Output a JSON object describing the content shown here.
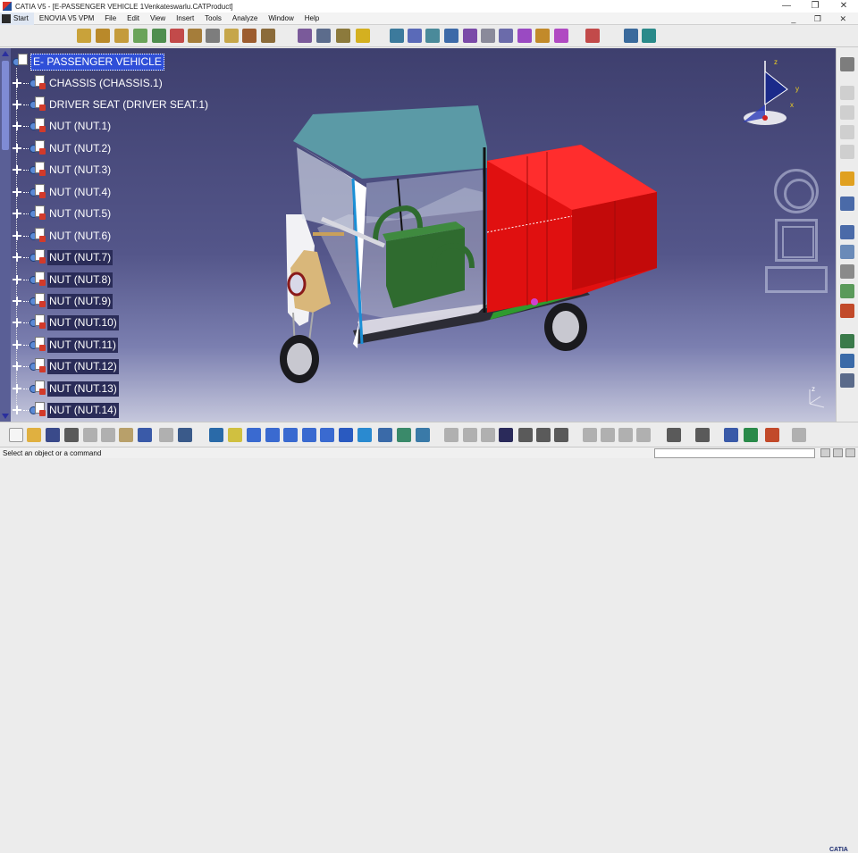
{
  "window": {
    "title": "CATIA V5 - [E-PASSENGER VEHICLE 1Venkateswarlu.CATProduct]",
    "controls": [
      "—",
      "❐",
      "✕"
    ]
  },
  "menu": {
    "items": [
      "Start",
      "ENOVIA V5 VPM",
      "File",
      "Edit",
      "View",
      "Insert",
      "Tools",
      "Analyze",
      "Window",
      "Help"
    ],
    "doc_controls": "_ ❐ ✕"
  },
  "tree": {
    "root": "E- PASSENGER VEHICLE",
    "items": [
      {
        "label": "CHASSIS (CHASSIS.1)"
      },
      {
        "label": "DRIVER SEAT (DRIVER SEAT.1)"
      },
      {
        "label": "NUT (NUT.1)"
      },
      {
        "label": "NUT (NUT.2)"
      },
      {
        "label": "NUT (NUT.3)"
      },
      {
        "label": "NUT (NUT.4)"
      },
      {
        "label": "NUT (NUT.5)"
      },
      {
        "label": "NUT (NUT.6)"
      },
      {
        "label": "NUT (NUT.7)"
      },
      {
        "label": "NUT (NUT.8)"
      },
      {
        "label": "NUT (NUT.9)"
      },
      {
        "label": "NUT (NUT.10)"
      },
      {
        "label": "NUT (NUT.11)"
      },
      {
        "label": "NUT (NUT.12)"
      },
      {
        "label": "NUT (NUT.13)"
      },
      {
        "label": "NUT (NUT.14)"
      }
    ]
  },
  "compass": {
    "x_label": "x",
    "y_label": "y",
    "z_label": "z"
  },
  "mini_axis": {
    "label": "z"
  },
  "status": {
    "prompt": "Select an object or a command"
  },
  "brand": "CATIA",
  "colors": {
    "viewport_top": "#3e3f6e",
    "viewport_bottom": "#c5c7dc",
    "cargo_red": "#e01010",
    "canopy_teal": "#5b9aa6",
    "seat_green": "#2f6b2f",
    "selection_blue": "#2f4fd8"
  }
}
